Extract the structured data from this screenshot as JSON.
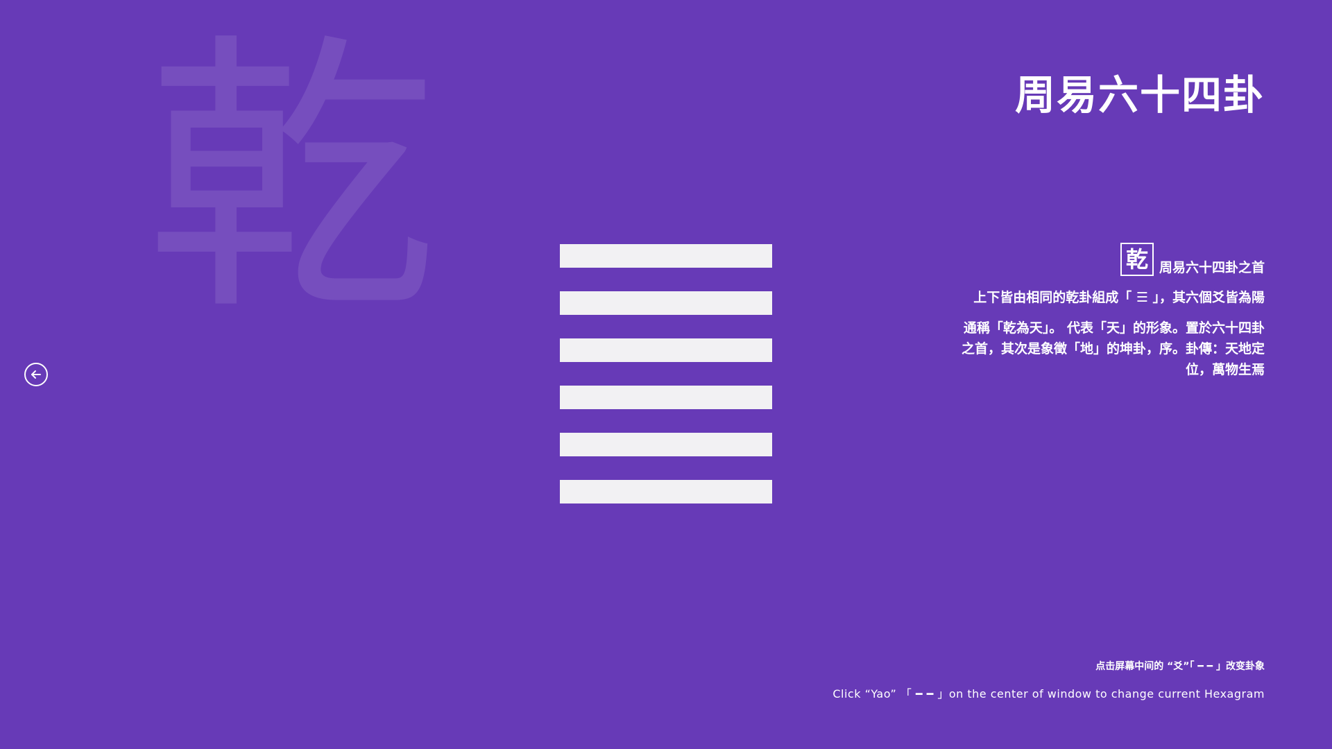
{
  "background_glyph": "乾",
  "app_title": "周易六十四卦",
  "back_button": {
    "icon": "arrow-left-circle-icon"
  },
  "hexagram": {
    "lines": [
      {
        "type": "yang"
      },
      {
        "type": "yang"
      },
      {
        "type": "yang"
      },
      {
        "type": "yang"
      },
      {
        "type": "yang"
      },
      {
        "type": "yang"
      }
    ]
  },
  "info": {
    "name": "乾",
    "subtitle": "周易六十四卦之首",
    "paragraph1": "上下皆由相同的乾卦組成「 ☰ 」，其六個爻皆為陽",
    "paragraph2": "通稱「乾為天」。 代表「天」的形象。置於六十四卦之首，其次是象徵「地」的坤卦，序。卦傳：天地定位，萬物生焉"
  },
  "hint": {
    "chinese": "点击屏幕中间的 “爻”「 ━ ━ 」改变卦象",
    "english": "Click “Yao” 「 ━ ━ 」on the center of window to change current Hexagram"
  },
  "colors": {
    "background": "#673AB7",
    "yao_line": "#F2F1F3",
    "text": "#FFFFFF"
  }
}
